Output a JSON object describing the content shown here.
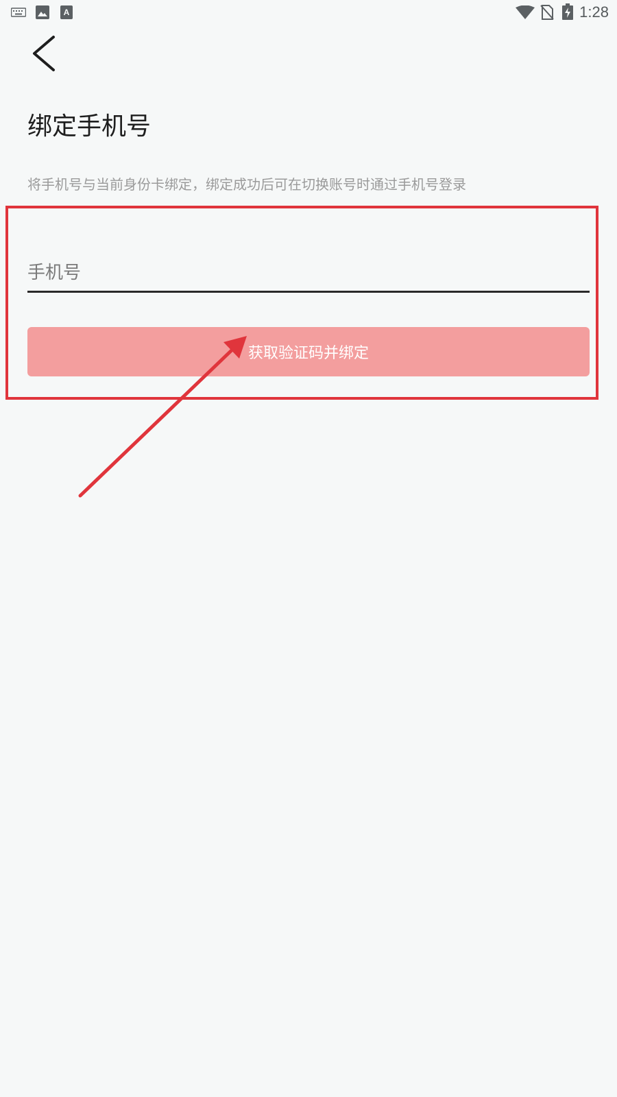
{
  "status_bar": {
    "time": "1:28",
    "icons": [
      "keyboard-icon",
      "image-icon",
      "font-icon",
      "wifi-icon",
      "no-sim-icon",
      "battery-charging-icon"
    ]
  },
  "header": {
    "back_icon": "chevron-left-icon",
    "title": "绑定手机号"
  },
  "main": {
    "description": "将手机号与当前身份卡绑定，绑定成功后可在切换账号时通过手机号登录",
    "phone_input": {
      "placeholder": "手机号",
      "value": ""
    },
    "bind_button_label": "获取验证码并绑定"
  },
  "colors": {
    "background": "#f6f8f8",
    "button": "#f39e9e",
    "annotation": "#e0353c"
  }
}
